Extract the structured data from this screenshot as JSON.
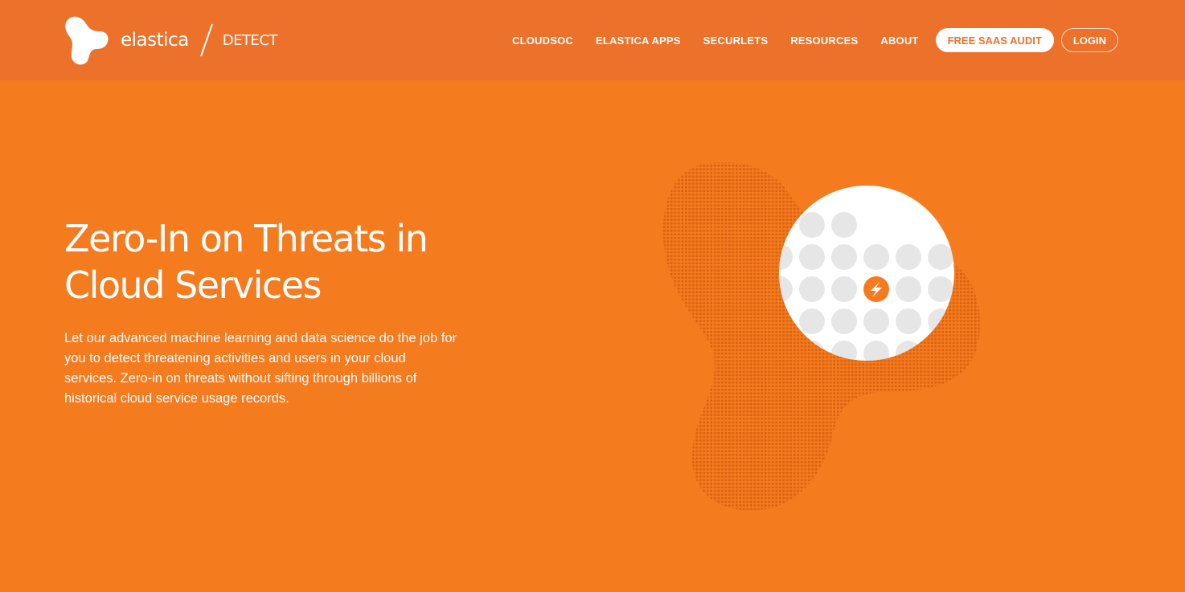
{
  "header": {
    "brand_name": "elastica",
    "product_name": "DETECT",
    "logo_icon": "elastica-blob-logo",
    "divider_icon": "slash-divider",
    "nav_links": [
      "CLOUDSOC",
      "ELASTICA APPS",
      "SECURLETS",
      "RESOURCES",
      "ABOUT"
    ],
    "cta_primary": "FREE SAAS AUDIT",
    "cta_secondary": "LOGIN"
  },
  "hero": {
    "title": "Zero-In on Threats in Cloud Services",
    "body": "Let our advanced machine learning and data science do the job for you to detect threatening activities and users in your cloud services. Zero-in on threats without sifting through billions of historical cloud service usage records.",
    "illustration_icon": "dotted-blob-magnifier",
    "threat_icon": "lightning-bolt-icon"
  },
  "colors": {
    "page_background": "#f57b1f",
    "header_background": "#ec712a",
    "dot_pattern": "#d9620f",
    "accent": "#f57b1f",
    "white": "#ffffff",
    "grey_dot": "#e6e6e6"
  }
}
